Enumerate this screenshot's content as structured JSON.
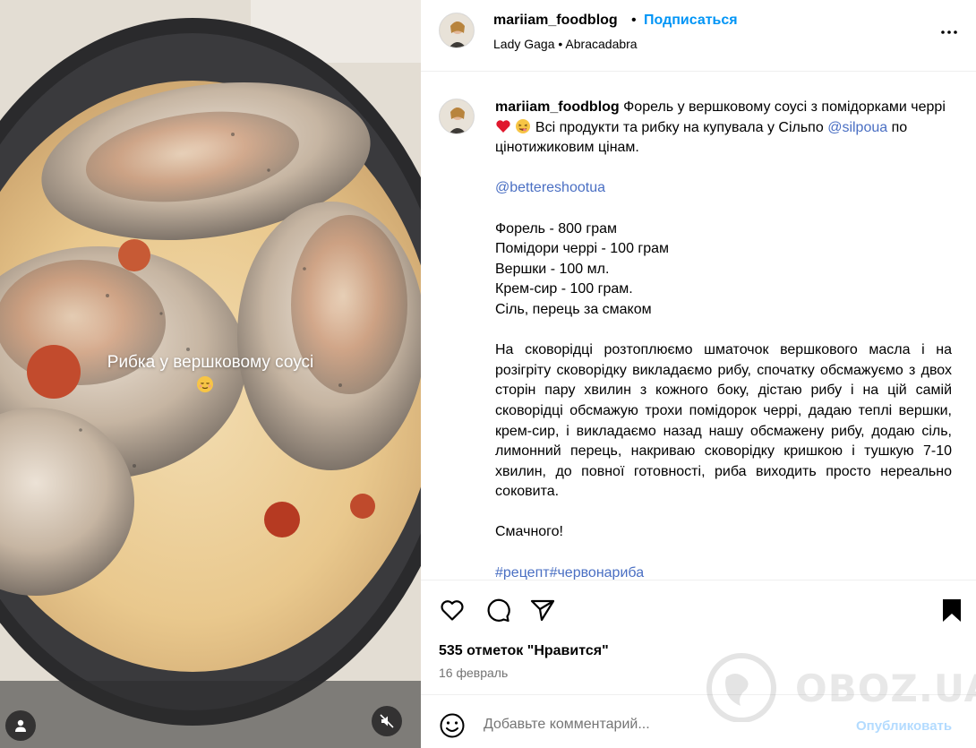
{
  "media": {
    "overlay_text": "Рибка у вершковому соусі",
    "overlay_emoji": "relieved-face-emoji",
    "user_tag_icon": "user-icon",
    "mute_icon": "speaker-muted-icon"
  },
  "header": {
    "username": "mariiam_foodblog",
    "separator": "•",
    "follow_label": "Подписаться",
    "audio_artist": "Lady Gaga",
    "audio_sep": " • ",
    "audio_track": "Abracadabra",
    "more_icon": "more-options-icon"
  },
  "caption": {
    "username": "mariiam_foodblog",
    "intro_a": "Форель у вершковому соусі з помідорками черрі",
    "intro_b": "Всі продукти та рибку на купувала у Сільпо",
    "mention_1": "@silpoua",
    "intro_c": "по цінотижиковим цінам.",
    "mention_2": "@bettereshootua",
    "ingredients": [
      "Форель - 800 грам",
      "Помідори черрі - 100 грам",
      "Вершки - 100 мл.",
      "Крем-сир - 100 грам.",
      "Сіль, перець за смаком"
    ],
    "method": "На сковорідці розтоплюємо шматочок вершкового масла і на розігріту сковорідку викладаємо рибу, спочатку обсмажуємо з двох сторін пару хвилин з кожного боку, дістаю рибу і на цій самій сковорідці обсмажую трохи помідорок черрі, дадаю теплі вершки, крем-сир, і викладаємо назад нашу обсмажену рибу, додаю сіль, лимонний перець, накриваю сковорідку кришкою і тушкую 7-10 хвилин, до повної готовності, риба виходить просто нереально соковита.",
    "closing": "Смачного!",
    "hashtags": "#рецепт#червонариба"
  },
  "actions": {
    "like_icon": "heart-icon",
    "comment_icon": "comment-bubble-icon",
    "share_icon": "paper-plane-icon",
    "save_icon": "bookmark-icon",
    "likes_text": "535 отметок \"Нравится\"",
    "date_text": "16 февраль"
  },
  "comment": {
    "emoji_icon": "smiley-icon",
    "placeholder": "Добавьте комментарий...",
    "publish_label": "Опубликовать"
  },
  "watermark": {
    "text": "OBOZ.UA"
  },
  "colors": {
    "link": "#4a6fc3",
    "follow": "#0095f6",
    "publish_disabled": "#b3dbff",
    "secondary_text": "#737373"
  }
}
